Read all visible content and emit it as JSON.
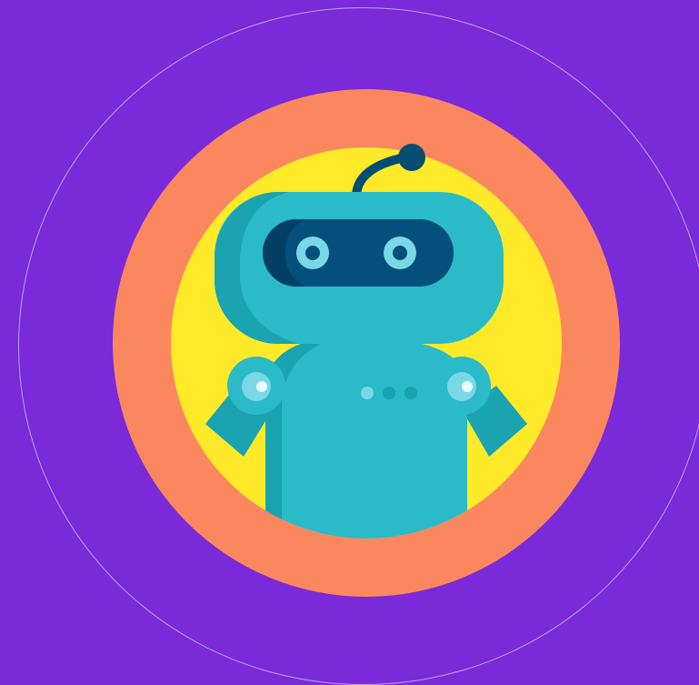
{
  "colors": {
    "background": "#7a2ad8",
    "ring": "#fb875f",
    "disc": "#ffea2a",
    "robot_body": "#2bbac7",
    "robot_shade": "#1aa3b1",
    "visor": "#044f7c",
    "eye": "#7ad7e6",
    "antenna": "#064d72"
  },
  "icons": {
    "avatar": "robot-icon"
  }
}
